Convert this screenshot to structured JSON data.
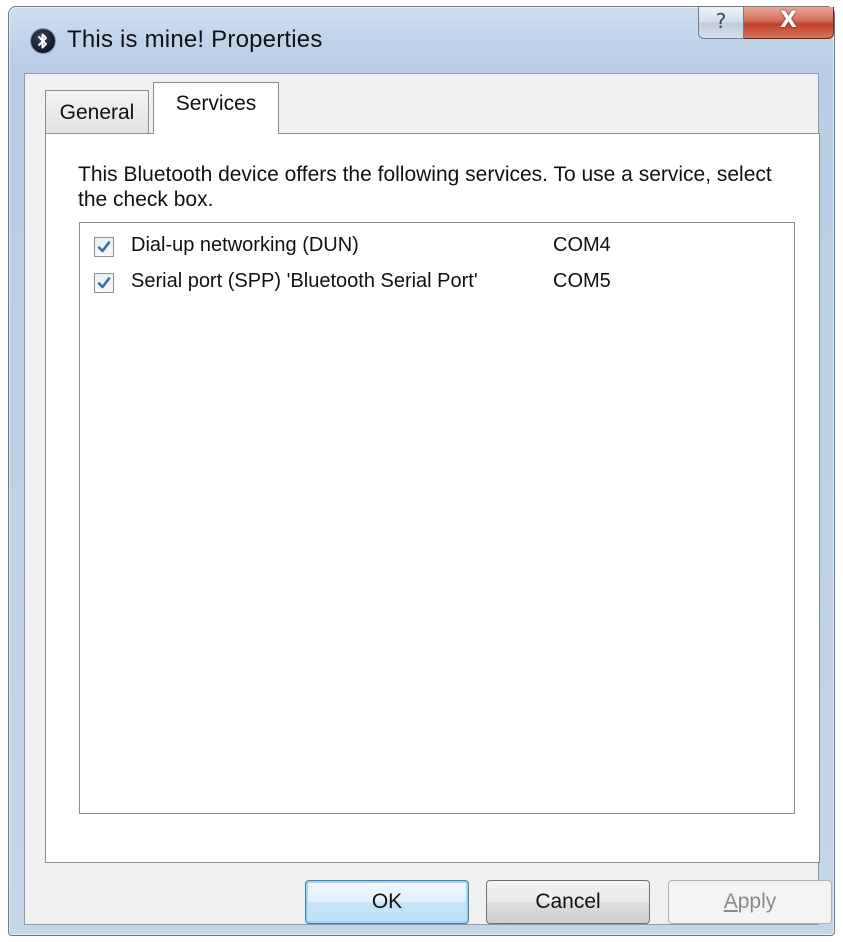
{
  "window": {
    "title": "This is mine! Properties",
    "title_icon": "bluetooth-icon",
    "help_glyph": "?",
    "close_glyph": "X"
  },
  "tabs": [
    {
      "label": "General",
      "selected": false
    },
    {
      "label": "Services",
      "selected": true
    }
  ],
  "services_panel": {
    "description": "This Bluetooth device offers the following services. To use a service, select the check box.",
    "services": [
      {
        "name": "Dial-up networking (DUN)",
        "port": "COM4",
        "checked": true
      },
      {
        "name": "Serial port (SPP) 'Bluetooth Serial Port'",
        "port": "COM5",
        "checked": true
      }
    ]
  },
  "buttons": {
    "ok": "OK",
    "cancel": "Cancel",
    "apply": "Apply",
    "apply_enabled": false
  },
  "colors": {
    "checkmark": "#3a6ea5",
    "ok_border": "#3c7fb1",
    "close_red": "#c0412a"
  }
}
